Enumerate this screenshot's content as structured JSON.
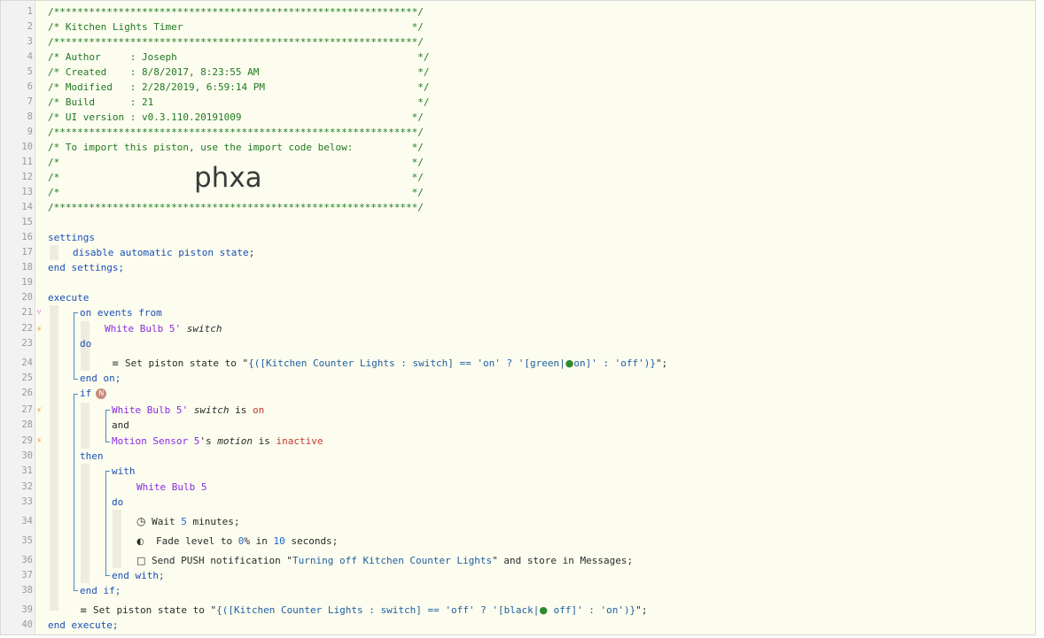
{
  "header": {
    "border_top": "/**************************************************************/",
    "title_line": "/* Kitchen Lights Timer                                       */",
    "border_2": "/**************************************************************/",
    "author_line": "/* Author     : Joseph                                         */",
    "created_line": "/* Created    : 8/8/2017, 8:23:55 AM                           */",
    "modified_line": "/* Modified   : 2/28/2019, 6:59:14 PM                          */",
    "build_line": "/* Build      : 21                                             */",
    "ui_line": "/* UI version : v0.3.110.20191009                             */",
    "border_3": "/**************************************************************/",
    "import_line": "/* To import this piston, use the import code below:          */",
    "blank_1": "/*                                                            */",
    "blank_2": "/*                                                            */",
    "blank_3": "/*                                                            */",
    "border_4": "/**************************************************************/",
    "import_code": "phxa"
  },
  "settings": {
    "open": "settings",
    "disable": "disable automatic piston state",
    "disable_end": ";",
    "close": "end settings;"
  },
  "execute": {
    "open": "execute",
    "on_events_from": "on events from",
    "event_device": "White Bulb 5'",
    "event_attr": "switch",
    "do": "do",
    "set_state_1_prefix": "Set piston state to \"",
    "set_state_1_expr_a": "{([Kitchen Counter Lights : switch] == 'on' ? '[green|",
    "set_state_1_expr_b": "on]' : 'off')}",
    "set_state_1_suffix": "\";",
    "end_on": "end on;",
    "if": "if",
    "if_badge": "N",
    "cond1_device": "White Bulb 5'",
    "cond1_attr": "switch",
    "cond1_is": " is ",
    "cond1_value": "on",
    "and": "and",
    "cond2_device": "Motion Sensor 5",
    "cond2_poss": "'s ",
    "cond2_attr": "motion",
    "cond2_is": " is ",
    "cond2_value": "inactive",
    "then": "then",
    "with": "with",
    "with_device": "White Bulb 5",
    "with_do": "do",
    "wait_text": "Wait ",
    "wait_num": "5",
    "wait_unit": " minutes;",
    "fade_text": "Fade level to ",
    "fade_level": "0",
    "fade_mid": "% in ",
    "fade_secs": "10",
    "fade_unit": " seconds;",
    "push_text": "Send PUSH notification \"",
    "push_msg": "Turning off Kitchen Counter Lights",
    "push_suffix": "\" and store in Messages;",
    "end_with": "end with;",
    "end_if": "end if;",
    "set_state_2_prefix": "Set piston state to \"",
    "set_state_2_expr_a": "{([Kitchen Counter Lights : switch] == 'off' ? '[black|",
    "set_state_2_expr_b": " off]' : 'on')}",
    "set_state_2_suffix": "\";",
    "close": "end execute;"
  },
  "line_numbers": [
    "1",
    "2",
    "3",
    "4",
    "5",
    "6",
    "7",
    "8",
    "9",
    "10",
    "11",
    "12",
    "13",
    "14",
    "15",
    "16",
    "17",
    "18",
    "19",
    "20",
    "21",
    "22",
    "23",
    "24",
    "25",
    "26",
    "27",
    "28",
    "29",
    "30",
    "31",
    "32",
    "33",
    "34",
    "35",
    "36",
    "37",
    "38",
    "39",
    "40"
  ],
  "icons": {
    "gutter_fork": "fork-icon",
    "gutter_bolt": "bolt-icon",
    "statement": "statement-lines-icon",
    "clock": "clock-icon",
    "toggle": "toggle-icon",
    "message": "message-bubble-icon",
    "bulb": "bulb-icon"
  },
  "colors": {
    "comment": "#1f7a1f",
    "keyword": "#1a4fb4",
    "device": "#8a2be2",
    "value": "#c0392b",
    "string": "#1f5fa0",
    "background": "#fcfcef"
  }
}
